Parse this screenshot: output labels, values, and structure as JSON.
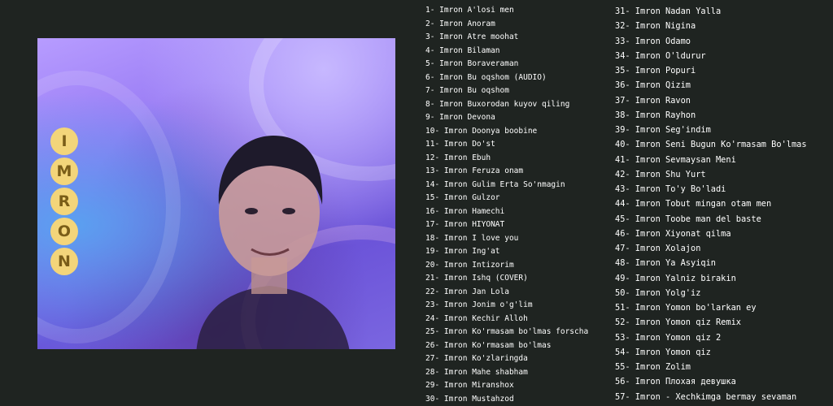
{
  "cover": {
    "letters": [
      "I",
      "M",
      "R",
      "O",
      "N"
    ],
    "colors": {
      "letter_bg": "#f3d57a",
      "letter_text": "#7a5d18",
      "page_bg": "#1f2421"
    }
  },
  "tracks_col1": [
    "1- Imron A'losi men",
    "2- Imron Anoram",
    "3- Imron Atre moohat",
    "4- Imron Bilaman",
    "5- Imron Boraveraman",
    "6- Imron Bu oqshom (AUDIO)",
    "7- Imron Bu oqshom",
    "8- Imron Buxorodan kuyov qiling",
    "9- Imron Devona",
    "10- Imron Doonya boobine",
    "11- Imron Do'st",
    "12- Imron Ebuh",
    "13- Imron Feruza onam",
    "14- Imron Gulim Erta So'nmagin",
    "15- Imron Gulzor",
    "16- Imron Hamechi",
    "17- Imron HIYONAT",
    "18- Imron I love you",
    "19- Imron Ing'at",
    "20- Imron Intizorim",
    "21- Imron Ishq (COVER)",
    "22- Imron Jan Lola",
    "23- Imron Jonim o'g'lim",
    "24- Imron Kechir Alloh",
    "25- Imron Ko'rmasam bo'lmas forscha",
    "26- Imron Ko'rmasam bo'lmas",
    "27- Imron Ko'zlaringda",
    "28- Imron Mahe shabham",
    "29- Imron Miranshox",
    "30- Imron Mustahzod"
  ],
  "tracks_col2": [
    "31- Imron Nadan Yalla",
    "32- Imron Nigina",
    "33- Imron Odamo",
    "34- Imron O'ldurur",
    "35- Imron Popuri",
    "36- Imron Qizim",
    "37- Imron Ravon",
    "38- Imron Rayhon",
    "39- Imron Seg'indim",
    "40- Imron Seni Bugun Ko'rmasam Bo'lmas",
    "41- Imron Sevmaysan Meni",
    "42- Imron Shu Yurt",
    "43- Imron To'y Bo'ladi",
    "44- Imron Tobut mingan otam men",
    "45- Imron Toobe man del baste",
    "46- Imron Xiyonat qilma",
    "47- Imron Xolajon",
    "48- Imron Ya Asyiqin",
    "49- Imron Yalniz birakin",
    "50- Imron Yolg'iz",
    "51- Imron Yomon bo'larkan ey",
    "52- Imron Yomon qiz Remix",
    "53- Imron Yomon qiz 2",
    "54- Imron Yomon qiz",
    "55- Imron Zolim",
    "56- Imron Плохая девушка",
    "57- Imron - Xechkimga bermay sevaman"
  ]
}
